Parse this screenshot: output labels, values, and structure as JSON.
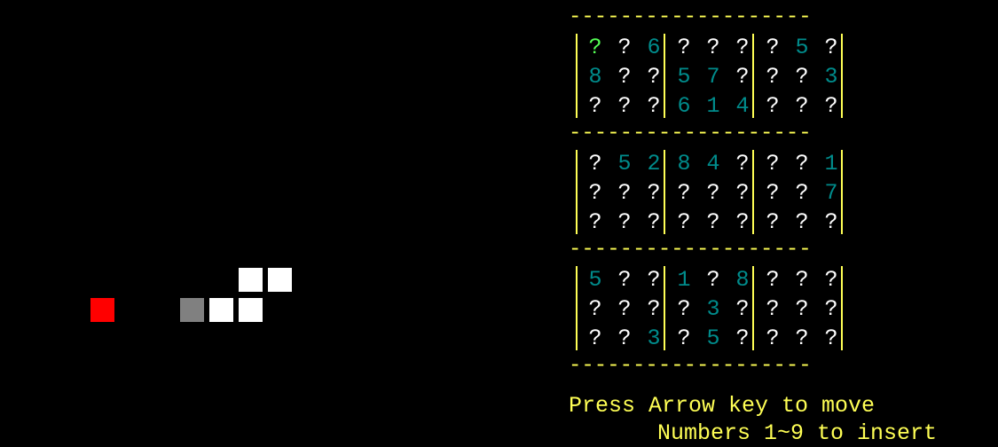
{
  "game": {
    "colors": {
      "background": "#000000",
      "grid_lines": "#ffff55",
      "hint_text": "#ffff55",
      "unknown_cell": "#ffffff",
      "given_cell": "#008b8b",
      "cursor_cell": "#55ff55",
      "apple": "#ff0000",
      "snake_body": "#ffffff",
      "snake_tail": "#808080"
    },
    "snake_canvas": {
      "apple": {
        "color": "red"
      },
      "snake": {
        "segments": [
          {
            "color": "white"
          },
          {
            "color": "white"
          },
          {
            "color": "white"
          },
          {
            "color": "white"
          },
          {
            "color": "white"
          },
          {
            "color": "gray"
          }
        ]
      }
    },
    "sudoku": {
      "separator": "-------------------",
      "cursor": {
        "row": 0,
        "col": 0
      },
      "rows": [
        [
          "?",
          "?",
          "6",
          "?",
          "?",
          "?",
          "?",
          "5",
          "?"
        ],
        [
          "8",
          "?",
          "?",
          "5",
          "7",
          "?",
          "?",
          "?",
          "3"
        ],
        [
          "?",
          "?",
          "?",
          "6",
          "1",
          "4",
          "?",
          "?",
          "?"
        ],
        [
          "?",
          "5",
          "2",
          "8",
          "4",
          "?",
          "?",
          "?",
          "1"
        ],
        [
          "?",
          "?",
          "?",
          "?",
          "?",
          "?",
          "?",
          "?",
          "7"
        ],
        [
          "?",
          "?",
          "?",
          "?",
          "?",
          "?",
          "?",
          "?",
          "?"
        ],
        [
          "5",
          "?",
          "?",
          "1",
          "?",
          "8",
          "?",
          "?",
          "?"
        ],
        [
          "?",
          "?",
          "?",
          "?",
          "3",
          "?",
          "?",
          "?",
          "?"
        ],
        [
          "?",
          "?",
          "3",
          "?",
          "5",
          "?",
          "?",
          "?",
          "?"
        ]
      ]
    },
    "instructions": {
      "line1": "Press Arrow key to move",
      "line2": "Numbers 1~9 to insert"
    }
  }
}
